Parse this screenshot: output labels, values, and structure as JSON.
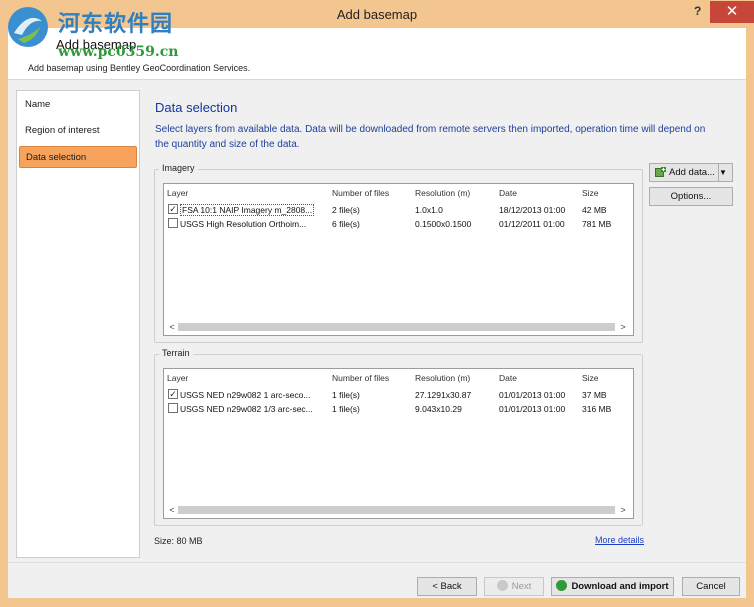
{
  "window": {
    "title": "Add basemap",
    "help": "?",
    "close": "✕"
  },
  "watermark": {
    "title": "河东软件园",
    "url": "www.pc0359.cn"
  },
  "header": {
    "title": "Add basemap",
    "subtitle": "Add basemap using Bentley GeoCoordination Services."
  },
  "sidebar": {
    "items": [
      {
        "label": "Name"
      },
      {
        "label": "Region of interest"
      },
      {
        "label": "Data selection"
      }
    ]
  },
  "section": {
    "title": "Data selection",
    "description": "Select layers from available data. Data will be downloaded from remote servers then imported, operation time will depend on the quantity and size of the data."
  },
  "columns": {
    "layer": "Layer",
    "files": "Number of files",
    "resolution": "Resolution (m)",
    "date": "Date",
    "size": "Size"
  },
  "imagery": {
    "label": "Imagery",
    "rows": [
      {
        "checked": "✓",
        "layer": "FSA 10:1 NAIP Imagery m_2808...",
        "files": "2 file(s)",
        "resolution": "1.0x1.0",
        "date": "18/12/2013 01:00",
        "size": "42 MB"
      },
      {
        "checked": "",
        "layer": "USGS High Resolution Orthoim...",
        "files": "6 file(s)",
        "resolution": "0.1500x0.1500",
        "date": "01/12/2011 01:00",
        "size": "781 MB"
      }
    ]
  },
  "terrain": {
    "label": "Terrain",
    "rows": [
      {
        "checked": "✓",
        "layer": "USGS NED n29w082 1 arc-seco...",
        "files": "1 file(s)",
        "resolution": "27.1291x30.87",
        "date": "01/01/2013 01:00",
        "size": "37 MB"
      },
      {
        "checked": "",
        "layer": "USGS NED n29w082 1/3 arc-sec...",
        "files": "1 file(s)",
        "resolution": "9.043x10.29",
        "date": "01/01/2013 01:00",
        "size": "316 MB"
      }
    ]
  },
  "buttons": {
    "add_data": "Add data...",
    "options": "Options...",
    "back": "< Back",
    "next": "Next",
    "download": "Download and import",
    "cancel": "Cancel"
  },
  "status": {
    "size": "Size: 80 MB",
    "more_details": "More details"
  },
  "colors": {
    "accent": "#f7a35c",
    "title_blue": "#14379e",
    "link": "#1a3fc4"
  }
}
